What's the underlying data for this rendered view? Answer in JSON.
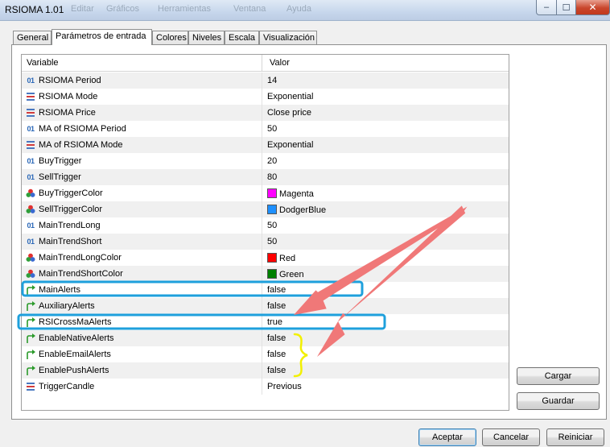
{
  "window": {
    "title": "RSIOMA 1.01",
    "background_menu": [
      "Editar",
      "Gráficos",
      "Herramientas",
      "Ventana",
      "Ayuda"
    ],
    "controls": {
      "minimize": "–",
      "maximize": "☐",
      "close": "✕"
    }
  },
  "tabs": [
    {
      "label": "General",
      "active": false
    },
    {
      "label": "Parámetros de entrada",
      "active": true
    },
    {
      "label": "Colores",
      "active": false
    },
    {
      "label": "Niveles",
      "active": false
    },
    {
      "label": "Escala",
      "active": false
    },
    {
      "label": "Visualización",
      "active": false
    }
  ],
  "grid": {
    "headers": {
      "variable": "Variable",
      "value": "Valor"
    },
    "rows": [
      {
        "name": "RSIOMA Period",
        "value": "14",
        "icon": "integer-icon"
      },
      {
        "name": "RSIOMA Mode",
        "value": "Exponential",
        "icon": "enum-icon"
      },
      {
        "name": "RSIOMA Price",
        "value": "Close price",
        "icon": "enum-icon"
      },
      {
        "name": "MA of RSIOMA Period",
        "value": "50",
        "icon": "integer-icon"
      },
      {
        "name": "MA of RSIOMA Mode",
        "value": "Exponential",
        "icon": "enum-icon"
      },
      {
        "name": "BuyTrigger",
        "value": "20",
        "icon": "integer-icon"
      },
      {
        "name": "SellTrigger",
        "value": "80",
        "icon": "integer-icon"
      },
      {
        "name": "BuyTriggerColor",
        "value": "Magenta",
        "icon": "color-icon",
        "color": "#ff00ff"
      },
      {
        "name": "SellTriggerColor",
        "value": "DodgerBlue",
        "icon": "color-icon",
        "color": "#1e90ff"
      },
      {
        "name": "MainTrendLong",
        "value": "50",
        "icon": "integer-icon"
      },
      {
        "name": "MainTrendShort",
        "value": "50",
        "icon": "integer-icon"
      },
      {
        "name": "MainTrendLongColor",
        "value": "Red",
        "icon": "color-icon",
        "color": "#ff0000"
      },
      {
        "name": "MainTrendShortColor",
        "value": "Green",
        "icon": "color-icon",
        "color": "#008000"
      },
      {
        "name": "MainAlerts",
        "value": "false",
        "icon": "bool-icon"
      },
      {
        "name": "AuxiliaryAlerts",
        "value": "false",
        "icon": "bool-icon"
      },
      {
        "name": "RSICrossMaAlerts",
        "value": "true",
        "icon": "bool-icon"
      },
      {
        "name": "EnableNativeAlerts",
        "value": "false",
        "icon": "bool-icon"
      },
      {
        "name": "EnableEmailAlerts",
        "value": "false",
        "icon": "bool-icon"
      },
      {
        "name": "EnablePushAlerts",
        "value": "false",
        "icon": "bool-icon"
      },
      {
        "name": "TriggerCandle",
        "value": "Previous",
        "icon": "enum-icon"
      }
    ]
  },
  "side_buttons": {
    "load": "Cargar",
    "save": "Guardar"
  },
  "footer_buttons": {
    "accept": "Aceptar",
    "cancel": "Cancelar",
    "reset": "Reiniciar"
  },
  "colors": {
    "highlight_box": "#1ea0dc",
    "arrow": "#f07878",
    "brace": "#f2f000",
    "tab_border": "#8e8f8f"
  }
}
